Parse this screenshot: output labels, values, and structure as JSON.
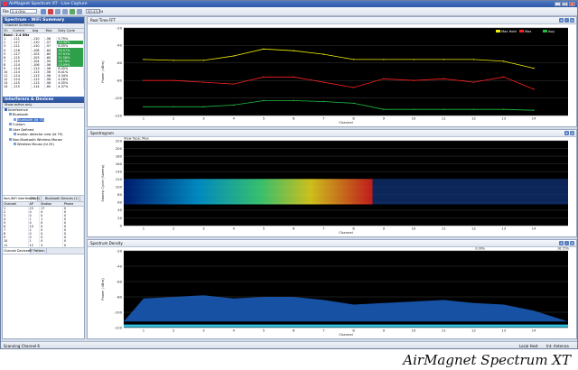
{
  "window": {
    "title": "AirMagnet Spectrum XT  -  Live Capture",
    "buttons": [
      "_",
      "□",
      "×"
    ]
  },
  "toolbar": {
    "file_label": "File",
    "band_value": "2.4 GHz",
    "time_value": "00:43:34"
  },
  "left": {
    "title": "Spectrum - WiFi Summary",
    "channel_summary": {
      "label": "Channel Summary",
      "columns": [
        "Ch",
        "Current",
        "Avg",
        "Max",
        "Duty Cycle"
      ],
      "group_label": "Band : 2.4 GHz",
      "rows": [
        [
          "1",
          "-111",
          "-110",
          "-56",
          "5.75%"
        ],
        [
          "2",
          "-117",
          "-110",
          "-57",
          "14.40%"
        ],
        [
          "3",
          "-111",
          "-110",
          "-57",
          "6.55%"
        ],
        [
          "4",
          "-116",
          "-108",
          "-64",
          "35.57%"
        ],
        [
          "5",
          "-117",
          "-103",
          "-60",
          "37.91%"
        ],
        [
          "6",
          "-115",
          "-103",
          "-60",
          "31.56%"
        ],
        [
          "7",
          "-115",
          "-104",
          "-59",
          "18.78%"
        ],
        [
          "8",
          "-114",
          "-106",
          "-56",
          "13.09%"
        ],
        [
          "9",
          "-114",
          "-113",
          "-56",
          "8.45%"
        ],
        [
          "10",
          "-114",
          "-113",
          "-56",
          "8.41%"
        ],
        [
          "11",
          "-114",
          "-113",
          "-56",
          "4.34%"
        ],
        [
          "12",
          "-114",
          "-113",
          "-56",
          "4.18%"
        ],
        [
          "13",
          "-115",
          "-113",
          "-56",
          "4.55%"
        ],
        [
          "14",
          "-115",
          "-114",
          "-60",
          "4.37%"
        ]
      ]
    },
    "interferers": {
      "title": "Interferers & Devices",
      "filter": "Show active only",
      "tree": [
        {
          "label": "Interference",
          "indent": 0
        },
        {
          "label": "Bluetooth",
          "indent": 1
        },
        {
          "label": "Bluetooth (Id 75)",
          "indent": 2,
          "selected": true
        },
        {
          "label": "Custom",
          "indent": 1
        },
        {
          "label": "User Defined",
          "indent": 1
        },
        {
          "label": "motion detector new (Id 79)",
          "indent": 2
        },
        {
          "label": "Non-Bluetooth Wireless Mouse",
          "indent": 1
        },
        {
          "label": "Wireless Mouse (Id 25)",
          "indent": 2
        }
      ]
    },
    "tabs": [
      "Non-WiFi Interfer (18)",
      "APs (6)",
      "Bluetooth Devices (1)"
    ],
    "ap_table": {
      "columns": [
        "Channel",
        "AP",
        "Station",
        "Phone"
      ],
      "rows": [
        [
          "1",
          "15",
          "17",
          "0"
        ],
        [
          "2",
          "0",
          "0",
          "0"
        ],
        [
          "3",
          "0",
          "0",
          "0"
        ],
        [
          "4",
          "1",
          "1",
          "0"
        ],
        [
          "5",
          "0",
          "0",
          "0"
        ],
        [
          "6",
          "10",
          "0",
          "0"
        ],
        [
          "7",
          "2",
          "0",
          "0"
        ],
        [
          "8",
          "0",
          "0",
          "0"
        ],
        [
          "9",
          "0",
          "0",
          "0"
        ],
        [
          "10",
          "1",
          "0",
          "0"
        ],
        [
          "11",
          "12",
          "3",
          "0"
        ]
      ]
    },
    "bottom_tabs": [
      "Channel Devices",
      "RF Pattern"
    ]
  },
  "charts": {
    "fft": {
      "title": "Real Time FFT",
      "ylabel": "Power (dBm)",
      "xlabel": "Channel",
      "yticks": [
        "-20",
        "-40",
        "-60",
        "-80",
        "-100",
        "-120"
      ],
      "legend": [
        {
          "name": "Max Hold",
          "color": "#f0f000"
        },
        {
          "name": "Max",
          "color": "#ff2020"
        },
        {
          "name": "Avg",
          "color": "#20c040"
        }
      ]
    },
    "spectrogram": {
      "title": "Spectrogram",
      "view_type": "View Type: Max",
      "ylabel": "Sweep Cycle (Sweep)",
      "xlabel": "Channel",
      "yticks": [
        "220",
        "200",
        "180",
        "160",
        "140",
        "120",
        "100",
        "80",
        "60",
        "40",
        "20",
        "0"
      ],
      "scale_min": "-100dBm",
      "scale_max": "-20dBm"
    },
    "density": {
      "title": "Spectrum Density",
      "ylabel": "Power (dBm)",
      "xlabel": "Channel",
      "yticks": [
        "-20",
        "-40",
        "-60",
        "-80",
        "-100",
        "-120"
      ],
      "scale_min": "0.00%",
      "scale_max": "16.75%"
    },
    "channels": [
      "1",
      "2",
      "3",
      "4",
      "5",
      "6",
      "7",
      "8",
      "9",
      "10",
      "11",
      "12",
      "13",
      "14"
    ]
  },
  "chart_data": [
    {
      "type": "line",
      "title": "Real Time FFT",
      "xlabel": "Channel",
      "ylabel": "Power (dBm)",
      "ylim": [
        -120,
        -20
      ],
      "categories": [
        "1",
        "2",
        "3",
        "4",
        "5",
        "6",
        "7",
        "8",
        "9",
        "10",
        "11",
        "12",
        "13",
        "14"
      ],
      "series": [
        {
          "name": "Max Hold",
          "values": [
            -56,
            -57,
            -57,
            -52,
            -44,
            -46,
            -50,
            -56,
            -56,
            -56,
            -56,
            -56,
            -58,
            -66
          ]
        },
        {
          "name": "Max",
          "values": [
            -80,
            -80,
            -82,
            -84,
            -76,
            -76,
            -82,
            -88,
            -78,
            -80,
            -78,
            -82,
            -76,
            -90
          ]
        },
        {
          "name": "Avg",
          "values": [
            -110,
            -110,
            -110,
            -108,
            -103,
            -103,
            -104,
            -106,
            -113,
            -113,
            -113,
            -113,
            -113,
            -114
          ]
        }
      ]
    },
    {
      "type": "heatmap",
      "title": "Spectrogram",
      "xlabel": "Channel",
      "ylabel": "Sweep Cycle (Sweep)",
      "ylim": [
        0,
        220
      ],
      "x": [
        "1",
        "2",
        "3",
        "4",
        "5",
        "6",
        "7",
        "8",
        "9",
        "10",
        "11",
        "12",
        "13",
        "14"
      ]
    },
    {
      "type": "heatmap",
      "title": "Spectrum Density",
      "xlabel": "Channel",
      "ylabel": "Power (dBm)",
      "ylim": [
        -120,
        -20
      ],
      "x": [
        "1",
        "2",
        "3",
        "4",
        "5",
        "6",
        "7",
        "8",
        "9",
        "10",
        "11",
        "12",
        "13",
        "14"
      ]
    }
  ],
  "status": {
    "left": "Scanning Channel 6",
    "host": "Local Host",
    "antenna": "Int. Antenna"
  },
  "caption": "AirMagnet Spectrum XT"
}
